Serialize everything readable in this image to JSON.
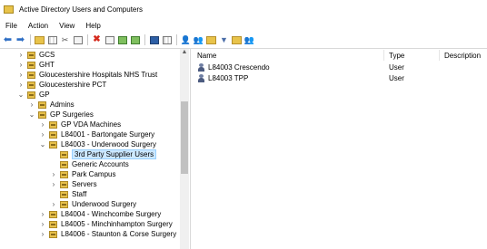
{
  "window": {
    "title": "Active Directory Users and Computers"
  },
  "menu": [
    "File",
    "Action",
    "View",
    "Help"
  ],
  "toolbar": {
    "icons": [
      "back-arrow-icon",
      "forward-arrow-icon",
      "folder-up-icon",
      "console-tree-icon",
      "cut-icon",
      "copy-icon",
      "delete-icon",
      "properties-icon",
      "refresh-icon",
      "export-list-icon",
      "help-icon",
      "snapin-icon",
      "new-user-icon",
      "new-group-icon",
      "new-ou-icon",
      "filter-icon",
      "add-to-group-icon",
      "delegate-icon"
    ]
  },
  "tree": {
    "items": [
      {
        "label": "GCS",
        "expander": "right"
      },
      {
        "label": "GHT",
        "expander": "right"
      },
      {
        "label": "Gloucestershire Hospitals NHS Trust",
        "expander": "right"
      },
      {
        "label": "Gloucestershire PCT",
        "expander": "right"
      },
      {
        "label": "GP",
        "expander": "down"
      },
      {
        "label": "Admins",
        "expander": "right"
      },
      {
        "label": "GP Surgeries",
        "expander": "down"
      },
      {
        "label": "GP VDA Machines",
        "expander": "right"
      },
      {
        "label": "L84001 - Bartongate Surgery",
        "expander": "right"
      },
      {
        "label": "L84003 - Underwood Surgery",
        "expander": "down"
      },
      {
        "label": "3rd Party Supplier Users",
        "expander": "",
        "selected": true
      },
      {
        "label": "Generic Accounts",
        "expander": ""
      },
      {
        "label": "Park Campus",
        "expander": "right"
      },
      {
        "label": "Servers",
        "expander": "right"
      },
      {
        "label": "Staff",
        "expander": ""
      },
      {
        "label": "Underwood Surgery",
        "expander": "right"
      },
      {
        "label": "L84004 - Winchcombe Surgery",
        "expander": "right"
      },
      {
        "label": "L84005 - Minchinhampton Surgery",
        "expander": "right"
      },
      {
        "label": "L84006 - Staunton & Corse Surgery",
        "expander": "right"
      }
    ]
  },
  "list": {
    "columns": {
      "name": "Name",
      "type": "Type",
      "description": "Description"
    },
    "rows": [
      {
        "name": "L84003 Crescendo",
        "type": "User",
        "description": ""
      },
      {
        "name": "L84003 TPP",
        "type": "User",
        "description": ""
      }
    ]
  }
}
